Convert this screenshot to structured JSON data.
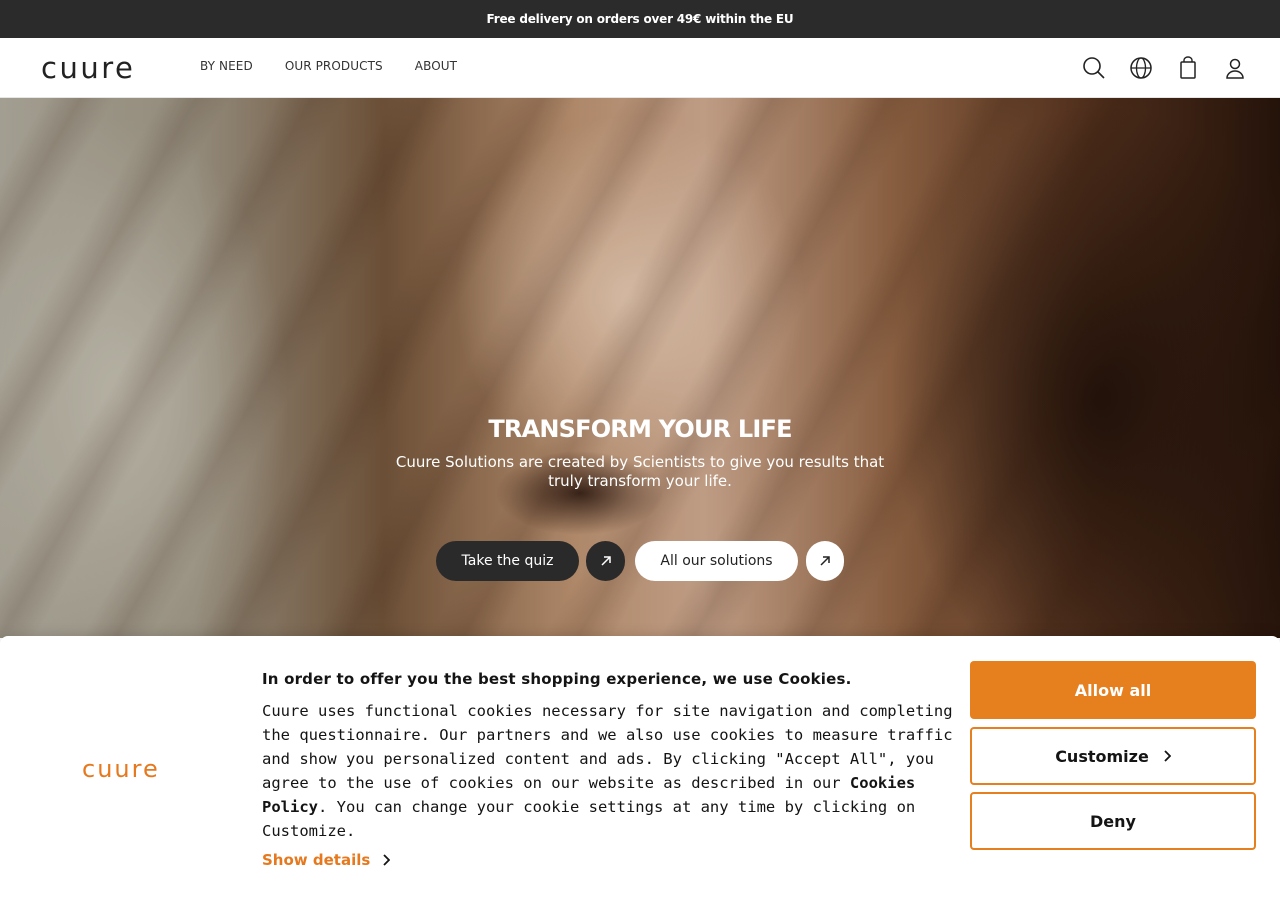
{
  "announcement": {
    "text": "Free delivery on orders over 49€ within the EU"
  },
  "header": {
    "logo": "cuure",
    "nav": [
      "BY NEED",
      "OUR PRODUCTS",
      "ABOUT"
    ],
    "icons": [
      "search-icon",
      "globe-icon",
      "bag-icon",
      "user-icon"
    ]
  },
  "hero": {
    "title": "TRANSFORM YOUR LIFE",
    "subtitle": "Cuure Solutions are created by Scientists to give you results that truly transform your life.",
    "quiz_label": "Take the quiz",
    "solutions_label": "All our solutions"
  },
  "cookie": {
    "logo": "cuure",
    "title": "In order to offer you the best shopping experience, we use Cookies.",
    "text_before": "Cuure uses functional cookies necessary for site navigation and completing the questionnaire. Our partners and we also use cookies to measure traffic and show you personalized content and ads. By clicking \"Accept All\", you agree to the use of cookies on our website as described in our ",
    "policy_link": "Cookies Policy",
    "text_after": ". You can change your cookie settings at any time by clicking on Customize.",
    "show_details": "Show details",
    "allow_label": "Allow all",
    "customize_label": "Customize",
    "deny_label": "Deny"
  },
  "colors": {
    "accent": "#e67f1e",
    "dark": "#2b2b2b"
  }
}
